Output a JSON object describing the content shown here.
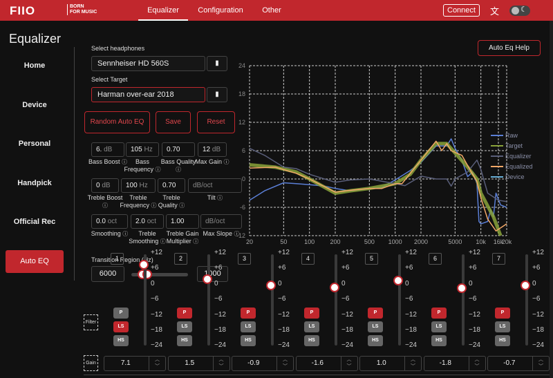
{
  "header": {
    "logo": "FIIO",
    "tagline_1": "BORN",
    "tagline_2": "FOR MUSIC",
    "tabs": [
      "Equalizer",
      "Configuration",
      "Other"
    ],
    "connect": "Connect",
    "lang_icon": "translate-icon"
  },
  "page_title": "Equalizer",
  "sidebar": [
    "Home",
    "Device",
    "Personal",
    "Handpick",
    "Official Rec",
    "Auto EQ"
  ],
  "autoeq": {
    "headphones_label": "Select headphones",
    "headphones": "Sennheiser HD 560S",
    "target_label": "Select Target",
    "target": "Harman over-ear 2018",
    "buttons": {
      "random": "Random Auto EQ",
      "save": "Save",
      "reset": "Reset",
      "help": "Auto Eq Help"
    },
    "params": [
      {
        "value": "6.",
        "unit": "dB",
        "label": "Bass Boost"
      },
      {
        "value": "105",
        "unit": "Hz",
        "label": "Bass Frequency"
      },
      {
        "value": "0.70",
        "unit": "",
        "label": "Bass Quality"
      },
      {
        "value": "12",
        "unit": "dB",
        "label": "Max Gain"
      },
      {
        "value": "0",
        "unit": "dB",
        "label": "Treble Boost"
      },
      {
        "value": "100",
        "unit": "Hz",
        "label": "Treble Frequency"
      },
      {
        "value": "0.70",
        "unit": "",
        "label": "Treble Quality"
      },
      {
        "value": "",
        "unit": "dB/oct",
        "label": "Tilt"
      },
      {
        "value": "0.0",
        "unit": "oct",
        "label": "Smoothing"
      },
      {
        "value": "2.0",
        "unit": "oct",
        "label": "Treble Smoothing"
      },
      {
        "value": "1.00",
        "unit": "",
        "label": "Treble Gain Multiplier"
      },
      {
        "value": "",
        "unit": "dB/oct",
        "label": "Max Slope"
      }
    ],
    "transition_label": "Transition Region (Hz)",
    "transition_low": "6000",
    "transition_high": "1000"
  },
  "bands": {
    "scale": [
      "+12",
      "+6",
      "0",
      "−6",
      "−12",
      "−18",
      "−24"
    ],
    "filter_label": "Filter",
    "gain_label": "Gain",
    "filter_types": [
      "P",
      "LS",
      "HS"
    ],
    "items": [
      {
        "num": "1",
        "type": "LS",
        "gain": "7.1"
      },
      {
        "num": "2",
        "type": "P",
        "gain": "1.5"
      },
      {
        "num": "3",
        "type": "P",
        "gain": "-0.9"
      },
      {
        "num": "4",
        "type": "P",
        "gain": "-1.6"
      },
      {
        "num": "5",
        "type": "P",
        "gain": "1.0"
      },
      {
        "num": "6",
        "type": "P",
        "gain": "-1.8"
      },
      {
        "num": "7",
        "type": "P",
        "gain": "-0.7"
      }
    ]
  },
  "chart_data": {
    "type": "line",
    "xscale": "log",
    "xlim": [
      20,
      20000
    ],
    "ylim": [
      -12,
      24
    ],
    "xticks": [
      "20",
      "50",
      "100",
      "200",
      "500",
      "1000",
      "2000",
      "5000",
      "10k",
      "16k",
      "20k"
    ],
    "xtick_values": [
      20,
      50,
      100,
      200,
      500,
      1000,
      2000,
      5000,
      10000,
      16000,
      20000
    ],
    "yticks": [
      24,
      18,
      12,
      6,
      0,
      -6,
      -12
    ],
    "grid": true,
    "legend": "right",
    "series": [
      {
        "name": "Raw",
        "color": "#5b7fd6",
        "width": 1.5,
        "points": [
          [
            20,
            -4.5
          ],
          [
            30,
            -2.5
          ],
          [
            50,
            -0.8
          ],
          [
            70,
            -1
          ],
          [
            100,
            -1.2
          ],
          [
            150,
            -1.5
          ],
          [
            200,
            -2
          ],
          [
            300,
            -2.5
          ],
          [
            500,
            -2
          ],
          [
            700,
            -1.8
          ],
          [
            1000,
            -0.2
          ],
          [
            1500,
            1.8
          ],
          [
            2000,
            3.5
          ],
          [
            3000,
            7
          ],
          [
            4000,
            7
          ],
          [
            4500,
            8.5
          ],
          [
            5000,
            6.5
          ],
          [
            6000,
            4
          ],
          [
            7000,
            0.5
          ],
          [
            8000,
            1.5
          ],
          [
            9000,
            -1
          ],
          [
            9500,
            -9
          ],
          [
            10000,
            -9.5
          ],
          [
            12000,
            -9
          ],
          [
            13000,
            -6.5
          ],
          [
            14000,
            -8
          ],
          [
            15000,
            -3
          ],
          [
            17000,
            -5.5
          ],
          [
            20000,
            -6
          ]
        ]
      },
      {
        "name": "Target",
        "color": "#8aa33a",
        "width": 5,
        "points": [
          [
            20,
            3
          ],
          [
            40,
            2.5
          ],
          [
            70,
            1.5
          ],
          [
            100,
            0
          ],
          [
            200,
            -3
          ],
          [
            300,
            -2.5
          ],
          [
            500,
            -2
          ],
          [
            1000,
            -1
          ],
          [
            1500,
            1
          ],
          [
            2000,
            4
          ],
          [
            3000,
            7.5
          ],
          [
            4000,
            7.5
          ],
          [
            5000,
            5.5
          ],
          [
            7000,
            2.5
          ],
          [
            9000,
            0
          ],
          [
            10000,
            -3
          ],
          [
            14000,
            -8
          ],
          [
            17000,
            -12
          ]
        ]
      },
      {
        "name": "Equalizer",
        "color": "#5a5f7a",
        "width": 1.5,
        "points": [
          [
            20,
            6.5
          ],
          [
            30,
            5
          ],
          [
            50,
            2.5
          ],
          [
            70,
            2.2
          ],
          [
            100,
            1
          ],
          [
            200,
            -0.7
          ],
          [
            300,
            -0.2
          ],
          [
            500,
            0
          ],
          [
            1000,
            -1
          ],
          [
            1300,
            -1.4
          ],
          [
            2000,
            0.6
          ],
          [
            3000,
            0
          ],
          [
            4000,
            0
          ],
          [
            4500,
            -1.5
          ],
          [
            5000,
            0
          ],
          [
            7000,
            1.5
          ],
          [
            9000,
            4
          ],
          [
            10000,
            2
          ],
          [
            12000,
            -3
          ],
          [
            16000,
            -4.5
          ],
          [
            20000,
            -4.8
          ]
        ]
      },
      {
        "name": "Equalized",
        "color": "#f2a868",
        "width": 1.5,
        "points": [
          [
            20,
            2.3
          ],
          [
            40,
            2.5
          ],
          [
            70,
            1.2
          ],
          [
            100,
            0
          ],
          [
            200,
            -2.8
          ],
          [
            300,
            -2.4
          ],
          [
            500,
            -2
          ],
          [
            700,
            -2
          ],
          [
            1000,
            -1
          ],
          [
            1200,
            -1
          ],
          [
            2000,
            4
          ],
          [
            3000,
            8
          ],
          [
            3500,
            6
          ],
          [
            4000,
            7.5
          ],
          [
            4500,
            6
          ],
          [
            6000,
            5
          ],
          [
            8000,
            1
          ],
          [
            9000,
            -0.5
          ],
          [
            10000,
            -4
          ],
          [
            12000,
            -8.5
          ],
          [
            15000,
            -11
          ],
          [
            20000,
            -9.5
          ]
        ]
      },
      {
        "name": "Device",
        "color": "#6ab0d8",
        "width": 1.5,
        "points": []
      }
    ]
  }
}
